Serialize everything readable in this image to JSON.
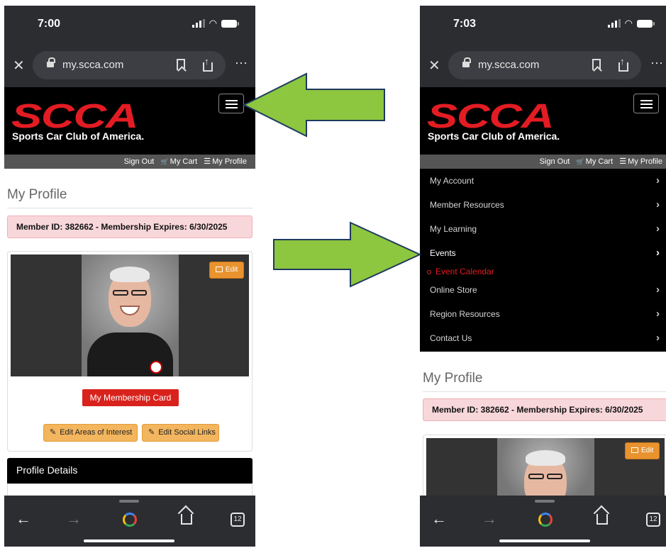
{
  "left": {
    "status_time": "7:00",
    "url": "my.scca.com",
    "logo_text": "SCCA",
    "tagline": "Sports Car Club of America.",
    "user_bar": {
      "sign_out": "Sign Out",
      "cart": "My Cart",
      "profile": "My Profile"
    },
    "page_title": "My Profile",
    "alert": "Member ID: 382662 - Membership Expires: 6/30/2025",
    "edit_label": "Edit",
    "membership_card_label": "My Membership Card",
    "edit_interest_label": "Edit Areas of Interest",
    "edit_social_label": "Edit Social Links",
    "profile_details_label": "Profile Details",
    "tabs_count": "12"
  },
  "right": {
    "status_time": "7:03",
    "url": "my.scca.com",
    "logo_text": "SCCA",
    "tagline": "Sports Car Club of America.",
    "user_bar": {
      "sign_out": "Sign Out",
      "cart": "My Cart",
      "profile": "My Profile"
    },
    "menu": [
      {
        "label": "My Account"
      },
      {
        "label": "Member Resources"
      },
      {
        "label": "My Learning"
      },
      {
        "label": "Events",
        "active": true
      },
      {
        "label": "Online Store"
      },
      {
        "label": "Region Resources"
      },
      {
        "label": "Contact Us"
      }
    ],
    "submenu_label": "Event Calendar",
    "page_title": "My Profile",
    "alert": "Member ID: 382662 - Membership Expires: 6/30/2025",
    "edit_label": "Edit",
    "tabs_count": "12"
  },
  "colors": {
    "scca_red": "#e31c23",
    "arrow_green": "#8dc63f",
    "arrow_outline": "#1f3a5f",
    "chrome_dark": "#2b2d31"
  },
  "icons": [
    "close-icon",
    "lock-icon",
    "bookmark-icon",
    "share-icon",
    "more-icon",
    "hamburger-icon",
    "cart-icon",
    "list-icon",
    "chevron-right-icon",
    "image-icon",
    "pencil-icon",
    "back-icon",
    "forward-icon",
    "google-lens-icon",
    "home-icon",
    "tabs-icon"
  ]
}
